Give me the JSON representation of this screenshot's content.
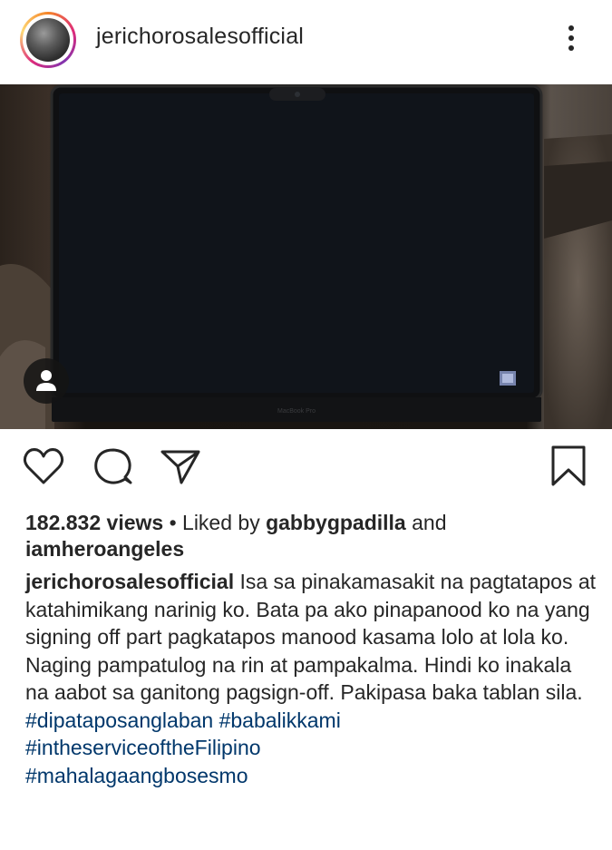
{
  "post": {
    "username": "jerichorosalesofficial",
    "views": "182.832 views",
    "separator": "•",
    "liked_by_prefix": "Liked by",
    "liked_by_user": "gabbygpadilla",
    "and": "and",
    "liked_by_other": "iamheroangeles",
    "caption_user": "jerichorosalesofficial",
    "caption_text": "Isa sa pinakamasakit na pagtatapos at katahimikang narinig ko. Bata pa ako pinapanood ko na yang signing off part pagkatapos manood kasama lolo at lola ko. Naging pampatulog na rin at pampakalma. Hindi ko inakala na aabot sa ganitong pagsign-off. Pakipasa baka tablan sila.",
    "hashtags": [
      "#dipataposanglaban #babalikkami",
      "#intheserviceoftheFilipino",
      "#mahalagaangbosesmo"
    ],
    "laptop_logo": "MacBook Pro"
  },
  "icons": {
    "more": "more-vertical-icon",
    "like": "heart-icon",
    "comment": "comment-icon",
    "share": "send-icon",
    "save": "bookmark-icon",
    "user_tag": "person-icon"
  },
  "colors": {
    "text": "#262626",
    "hashtag": "#00376b",
    "background": "#ffffff"
  }
}
